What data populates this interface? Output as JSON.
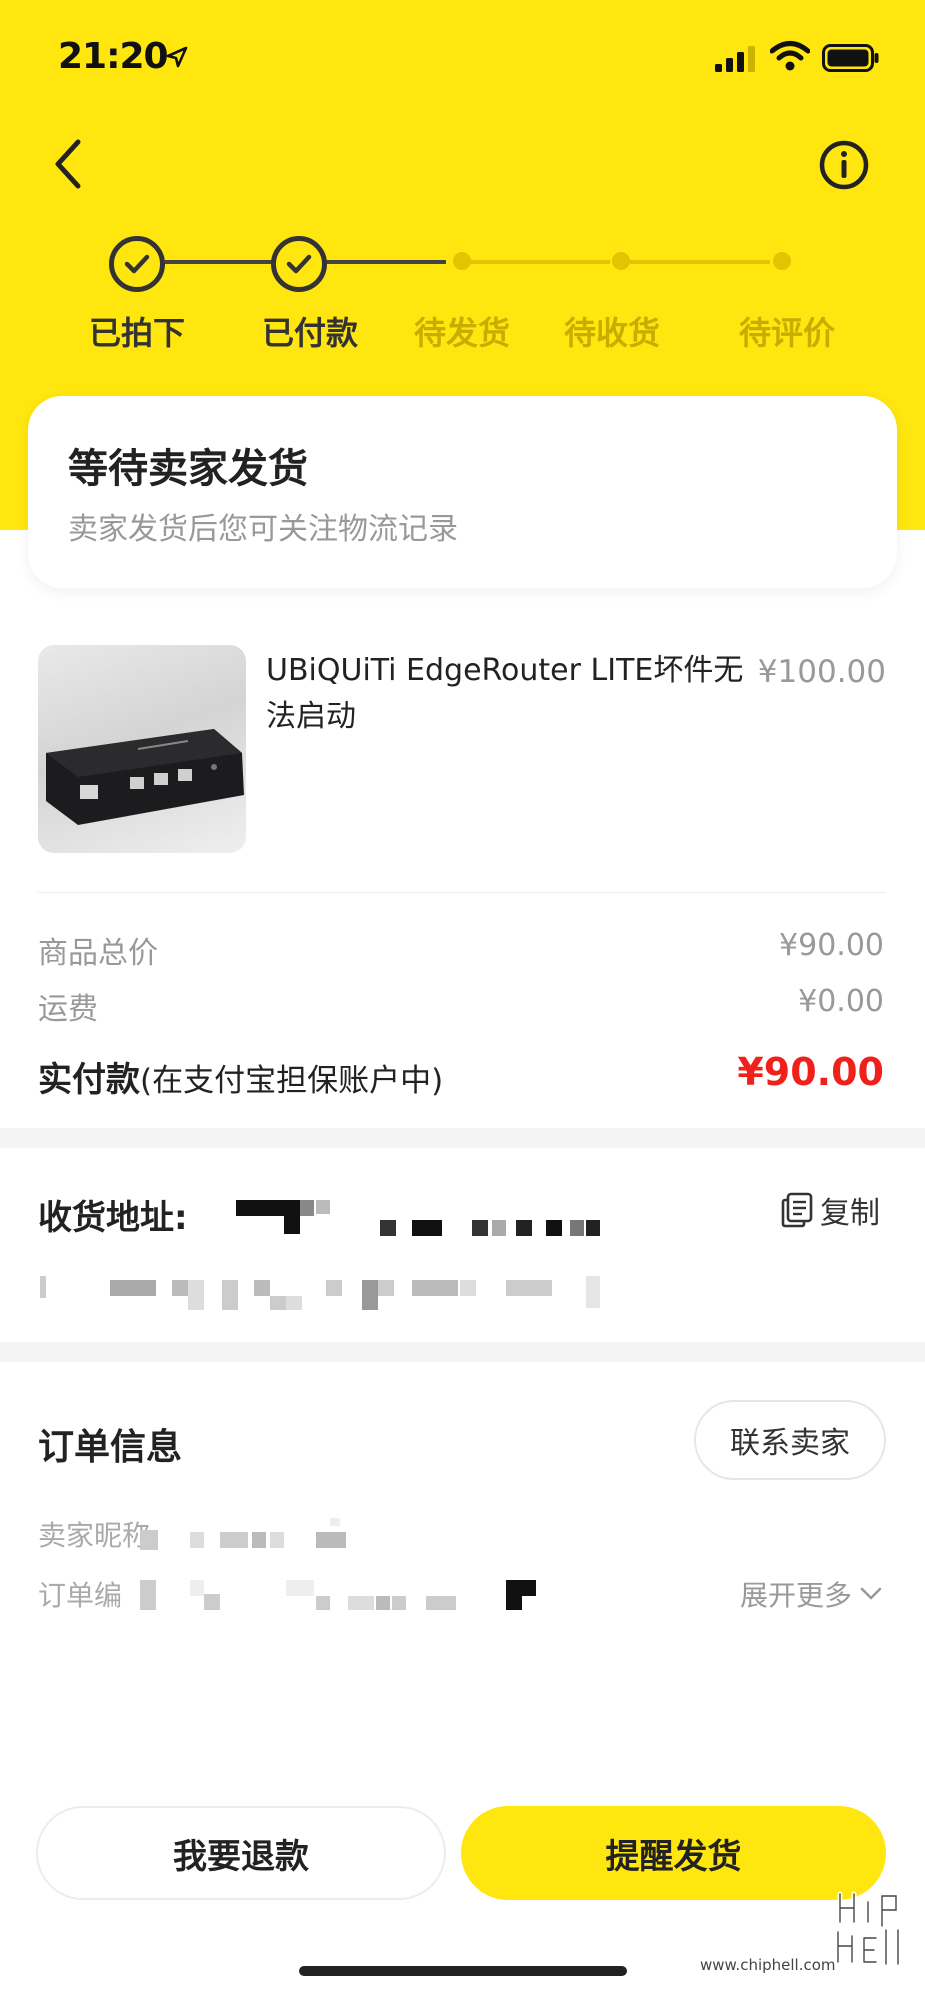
{
  "status_bar": {
    "time": "21:20"
  },
  "progress": {
    "steps": [
      {
        "label": "已拍下",
        "state": "done"
      },
      {
        "label": "已付款",
        "state": "done"
      },
      {
        "label": "待发货",
        "state": "todo"
      },
      {
        "label": "待收货",
        "state": "todo"
      },
      {
        "label": "待评价",
        "state": "todo"
      }
    ]
  },
  "status_card": {
    "title": "等待卖家发货",
    "subtitle": "卖家发货后您可关注物流记录"
  },
  "product": {
    "title": "UBiQUiTi EdgeRouter LITE坏件无法启动",
    "price": "¥100.00"
  },
  "pricing": {
    "goods_total_label": "商品总价",
    "goods_total_value": "¥90.00",
    "shipping_label": "运费",
    "shipping_value": "¥0.00",
    "paid_label": "实付款",
    "paid_note": "(在支付宝担保账户中)",
    "paid_value": "¥90.00"
  },
  "address": {
    "title": "收货地址:",
    "copy_label": "复制"
  },
  "order_info": {
    "title": "订单信息",
    "contact_label": "联系卖家",
    "seller_nick_label": "卖家昵称",
    "order_no_label": "订单编",
    "expand_label": "展开更多"
  },
  "actions": {
    "refund_label": "我要退款",
    "remind_label": "提醒发货"
  },
  "watermark": {
    "text": "www.chiphell.com"
  },
  "colors": {
    "brand_yellow": "#ffe60f",
    "price_red": "#f0201a",
    "muted_text": "#999999"
  }
}
